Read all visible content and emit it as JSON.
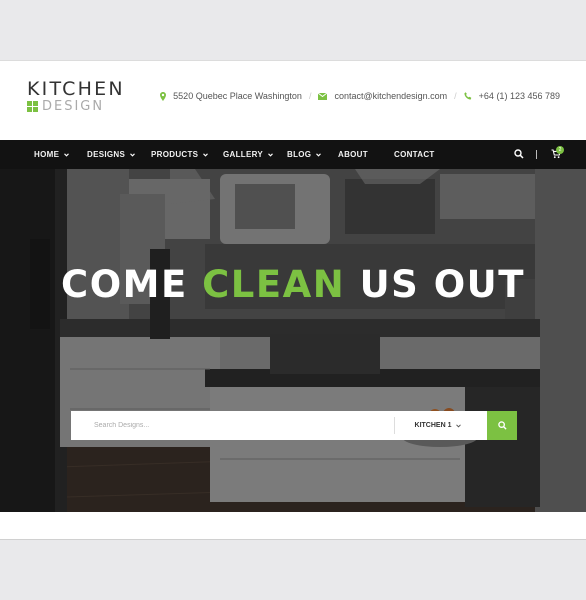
{
  "logo": {
    "main": "KITCHEN",
    "sub": "DESIGN"
  },
  "contacts": {
    "address": "5520 Quebec Place Washington",
    "email": "contact@kitchendesign.com",
    "phone": "+64 (1) 123 456 789",
    "separator": "/"
  },
  "nav": {
    "items": [
      {
        "label": "HOME"
      },
      {
        "label": "DESIGNS"
      },
      {
        "label": "PRODUCTS"
      },
      {
        "label": "GALLERY"
      },
      {
        "label": "BLOG"
      },
      {
        "label": "ABOUT"
      },
      {
        "label": "CONTACT"
      }
    ],
    "cart_count": "2"
  },
  "hero": {
    "title_part1": "COME ",
    "title_accent": "CLEAN",
    "title_part2": " US OUT"
  },
  "search": {
    "placeholder": "Search Designs...",
    "select_value": "KITCHEN 1"
  },
  "colors": {
    "accent": "#7cc142",
    "nav_bg": "#121212"
  }
}
